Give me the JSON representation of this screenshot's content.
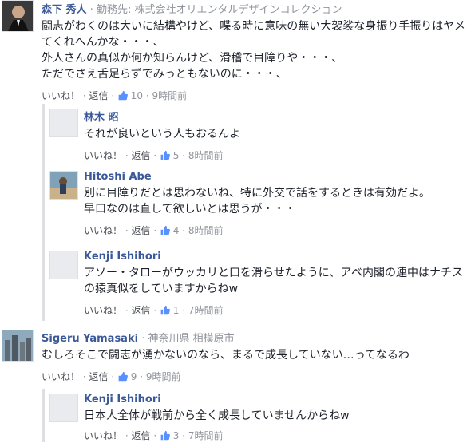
{
  "comments": [
    {
      "name": "森下 秀人",
      "meta_sep": " · ",
      "meta_prefix": "勤務先: ",
      "meta_link": "株式会社オリエンタルデザインコレクション",
      "lines": [
        "闘志がわくのは大いに結構やけど、喋る時に意味の無い大袈裟な身振り手振りはヤメ",
        "てくれへんかな・・・、",
        "外人さんの真似か何か知らんけど、滑稽で目障りや・・・、",
        "ただでさえ舌足らずでみっともないのに・・・、"
      ],
      "like": "いいね！",
      "reply": "返信",
      "likes": "10",
      "time": "9時間前"
    },
    {
      "name": "林木 昭",
      "lines": [
        "それが良いという人もおるんよ"
      ],
      "like": "いいね！",
      "reply": "返信",
      "likes": "5",
      "time": "8時間前"
    },
    {
      "name": "Hitoshi Abe",
      "lines": [
        "別に目障りだとは思わないね、特に外交で話をするときは有効だよ。",
        "早口なのは直して欲しいとは思うが・・・"
      ],
      "like": "いいね！",
      "reply": "返信",
      "likes": "4",
      "time": "8時間前"
    },
    {
      "name": "Kenji Ishihori",
      "lines": [
        "アソー・タローがウッカリと口を滑らせたように、アベ内閣の連中はナチス",
        "の猿真似をしていますからねw"
      ],
      "like": "いいね！",
      "reply": "返信",
      "likes": "1",
      "time": "7時間前"
    },
    {
      "name": "Sigeru Yamasaki",
      "meta_sep": " · ",
      "meta_link": "神奈川県 相模原市",
      "lines": [
        "むしろそこで闘志が湧かないのなら、まるで成長していない…ってなるわ"
      ],
      "like": "いいね！",
      "reply": "返信",
      "likes": "9",
      "time": "9時間前"
    },
    {
      "name": "Kenji Ishihori",
      "lines": [
        "日本人全体が戦前から全く成長していませんからねw"
      ],
      "like": "いいね！",
      "reply": "返信",
      "likes": "3",
      "time": "7時間前"
    }
  ],
  "colors": {
    "name": "#3b5998",
    "meta": "#90949c",
    "link": "#365899",
    "bar": "#dddfe2"
  },
  "icons": [
    "thumbs-up-icon",
    "default-avatar-icon"
  ]
}
